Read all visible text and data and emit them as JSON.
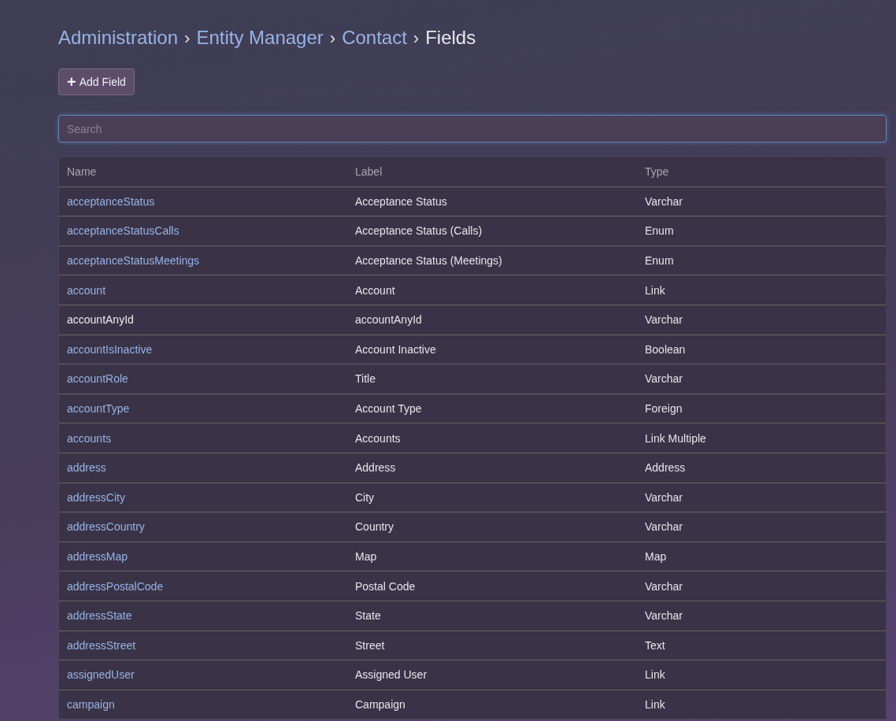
{
  "breadcrumb": [
    {
      "label": "Administration",
      "link": true
    },
    {
      "label": "Entity Manager",
      "link": true
    },
    {
      "label": "Contact",
      "link": true
    },
    {
      "label": "Fields",
      "link": false
    }
  ],
  "separator": "›",
  "add_button": {
    "icon": "+",
    "label": "Add Field"
  },
  "search": {
    "placeholder": "Search"
  },
  "table": {
    "columns": [
      "Name",
      "Label",
      "Type"
    ],
    "rows": [
      {
        "name": "acceptanceStatus",
        "link": true,
        "label": "Acceptance Status",
        "type": "Varchar"
      },
      {
        "name": "acceptanceStatusCalls",
        "link": true,
        "label": "Acceptance Status (Calls)",
        "type": "Enum"
      },
      {
        "name": "acceptanceStatusMeetings",
        "link": true,
        "label": "Acceptance Status (Meetings)",
        "type": "Enum"
      },
      {
        "name": "account",
        "link": true,
        "label": "Account",
        "type": "Link"
      },
      {
        "name": "accountAnyId",
        "link": false,
        "label": "accountAnyId",
        "type": "Varchar"
      },
      {
        "name": "accountIsInactive",
        "link": true,
        "label": "Account Inactive",
        "type": "Boolean"
      },
      {
        "name": "accountRole",
        "link": true,
        "label": "Title",
        "type": "Varchar"
      },
      {
        "name": "accountType",
        "link": true,
        "label": "Account Type",
        "type": "Foreign"
      },
      {
        "name": "accounts",
        "link": true,
        "label": "Accounts",
        "type": "Link Multiple"
      },
      {
        "name": "address",
        "link": true,
        "label": "Address",
        "type": "Address"
      },
      {
        "name": "addressCity",
        "link": true,
        "label": "City",
        "type": "Varchar"
      },
      {
        "name": "addressCountry",
        "link": true,
        "label": "Country",
        "type": "Varchar"
      },
      {
        "name": "addressMap",
        "link": true,
        "label": "Map",
        "type": "Map"
      },
      {
        "name": "addressPostalCode",
        "link": true,
        "label": "Postal Code",
        "type": "Varchar"
      },
      {
        "name": "addressState",
        "link": true,
        "label": "State",
        "type": "Varchar"
      },
      {
        "name": "addressStreet",
        "link": true,
        "label": "Street",
        "type": "Text"
      },
      {
        "name": "assignedUser",
        "link": true,
        "label": "Assigned User",
        "type": "Link"
      },
      {
        "name": "campaign",
        "link": true,
        "label": "Campaign",
        "type": "Link"
      }
    ]
  }
}
